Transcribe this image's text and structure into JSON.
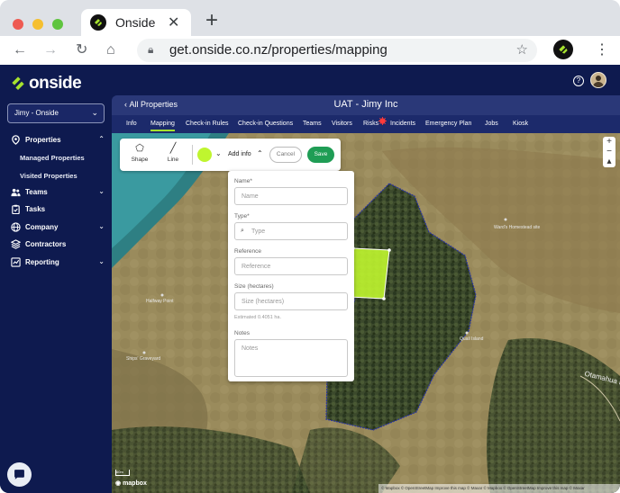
{
  "browser": {
    "tab_title": "Onside",
    "tab_close": "✕",
    "new_tab": "+",
    "url": "get.onside.co.nz/properties/mapping"
  },
  "sidebar": {
    "brand": "onside",
    "org_select": "Jimy - Onside",
    "items": [
      {
        "label": "Properties",
        "icon": "location-pin-icon",
        "expanded": true
      },
      {
        "label": "Teams",
        "icon": "people-icon"
      },
      {
        "label": "Tasks",
        "icon": "clipboard-icon"
      },
      {
        "label": "Company",
        "icon": "globe-icon"
      },
      {
        "label": "Contractors",
        "icon": "layers-icon"
      },
      {
        "label": "Reporting",
        "icon": "chart-icon"
      }
    ],
    "sub_items": [
      "Managed Properties",
      "Visited Properties"
    ]
  },
  "header": {
    "back_label": "All Properties",
    "title": "UAT - Jimy Inc"
  },
  "tabs": [
    "Info",
    "Mapping",
    "Check-in Rules",
    "Check-in Questions",
    "Teams",
    "Visitors",
    "Risks",
    "Incidents",
    "Emergency Plan",
    "Jobs",
    "Kiosk"
  ],
  "active_tab": "Mapping",
  "draw_toolbar": {
    "shape_label": "Shape",
    "line_label": "Line",
    "color": "#bff52f",
    "add_info_label": "Add info",
    "cancel_label": "Cancel",
    "save_label": "Save"
  },
  "form": {
    "name_label": "Name*",
    "name_placeholder": "Name",
    "type_label": "Type*",
    "type_placeholder": "Type",
    "reference_label": "Reference",
    "reference_placeholder": "Reference",
    "size_label": "Size (hectares)",
    "size_placeholder": "Size (hectares)",
    "size_hint": "Estimated 0.4051 ha.",
    "notes_label": "Notes",
    "notes_placeholder": "Notes"
  },
  "map": {
    "labels": {
      "halfway_point": "Halfway Point",
      "ships_graveyard": "Ships' Graveyard",
      "wards_homestead": "Ward's Homestead site",
      "quail_island": "Quail Island",
      "otamahua": "Otamahua R"
    },
    "zoom_in": "+",
    "zoom_out": "−",
    "scale": "60m",
    "logo": "mapbox",
    "attribution": "© Mapbox © OpenStreetMap Improve this map © Maxar © Mapbox © OpenStreetMap Improve this map © Maxar"
  },
  "colors": {
    "sidebar_bg": "#0e1a4f",
    "accent_green": "#a6e22e",
    "save_green": "#1f9d55"
  }
}
